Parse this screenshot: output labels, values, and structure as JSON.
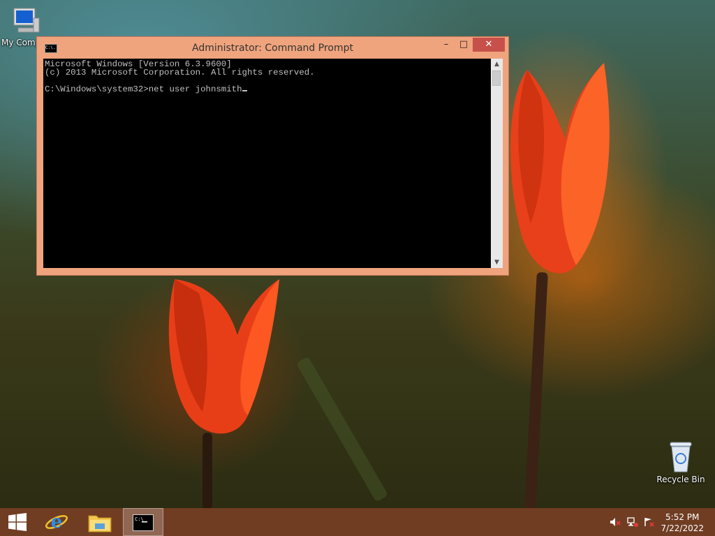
{
  "desktop": {
    "icons": [
      {
        "label": "My Comp",
        "icon": "computer-icon"
      },
      {
        "label": "Recycle Bin",
        "icon": "recycle-bin-icon"
      }
    ]
  },
  "window": {
    "title": "Administrator: Command Prompt",
    "icon_text": "C:\\.",
    "controls": {
      "minimize": "–",
      "maximize": "□",
      "close": "✕"
    },
    "console_lines": [
      "Microsoft Windows [Version 6.3.9600]",
      "(c) 2013 Microsoft Corporation. All rights reserved.",
      "",
      "C:\\Windows\\system32>net user johnsmith"
    ]
  },
  "taskbar": {
    "items": [
      "start-button-icon",
      "internet-explorer-icon",
      "file-explorer-icon",
      "command-prompt-icon"
    ],
    "tray": [
      "volume-muted-icon",
      "network-icon",
      "action-center-icon"
    ],
    "time": "5:52 PM",
    "date": "7/22/2022"
  },
  "colors": {
    "titlebar": "#f0a47d",
    "close_button": "#c7504a",
    "taskbar": "#7a4026"
  }
}
